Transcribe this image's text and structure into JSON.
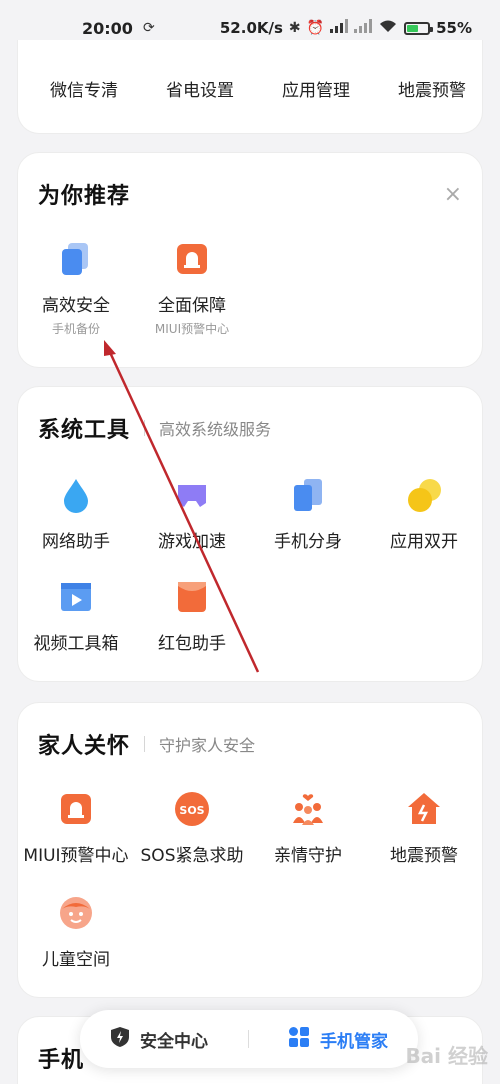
{
  "status_bar": {
    "time": "20:00",
    "speed": "52.0K/s",
    "signal1": "HD",
    "signal2": "HD",
    "battery_percent": "55%",
    "battery_level": 0.55
  },
  "top_card": {
    "items": [
      "微信专清",
      "省电设置",
      "应用管理",
      "地震预警"
    ]
  },
  "recommend": {
    "title": "为你推荐",
    "close": "×",
    "items": [
      {
        "label": "高效安全",
        "sub": "手机备份"
      },
      {
        "label": "全面保障",
        "sub": "MIUI预警中心"
      }
    ]
  },
  "system_tools": {
    "title": "系统工具",
    "subtitle": "高效系统级服务",
    "items": [
      "网络助手",
      "游戏加速",
      "手机分身",
      "应用双开",
      "视频工具箱",
      "红包助手"
    ]
  },
  "family": {
    "title": "家人关怀",
    "subtitle": "守护家人安全",
    "items": [
      "MIUI预警中心",
      "SOS紧急求助",
      "亲情守护",
      "地震预警",
      "儿童空间"
    ],
    "sos_text": "SOS"
  },
  "partial_card": {
    "title": "手机"
  },
  "bottom_nav": {
    "security_center": "安全中心",
    "phone_manager": "手机管家"
  },
  "watermark": "Bai 经验",
  "colors": {
    "accent_blue": "#2b7ef5",
    "orange": "#f26b3a",
    "purple": "#8e7cf5",
    "yellow": "#f5c518",
    "water_blue": "#3aa7f2"
  }
}
